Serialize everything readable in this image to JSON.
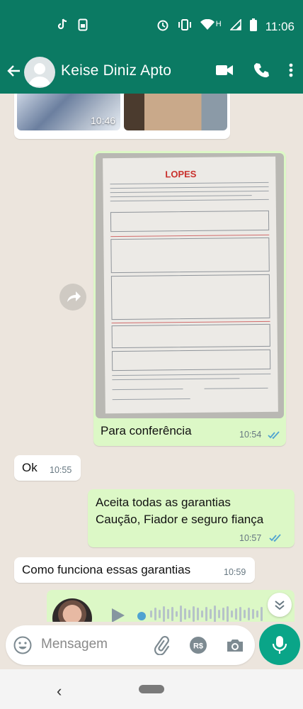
{
  "status_bar": {
    "time": "11:06",
    "network_letter": "H"
  },
  "header": {
    "title": "Keise Diniz Apto"
  },
  "media_preview": {
    "time": "10:46"
  },
  "document_message": {
    "doc_logo": "LOPES",
    "caption": "Para conferência",
    "time": "10:54",
    "status": "read"
  },
  "messages": [
    {
      "id": "m1",
      "direction": "in",
      "text": "Ok",
      "time": "10:55"
    },
    {
      "id": "m2",
      "direction": "out",
      "lines": [
        "Aceita todas as garantias",
        "Caução, Fiador e seguro fiança"
      ],
      "time": "10:57",
      "status": "read"
    },
    {
      "id": "m3",
      "direction": "in",
      "text": "Como funciona essas garantias",
      "time": "10:59"
    }
  ],
  "composer": {
    "placeholder": "Mensagem"
  },
  "colors": {
    "header": "#0b7a63",
    "outgoing": "#dcf8c6",
    "incoming": "#ffffff",
    "accent": "#0aa588",
    "read_ticks": "#4fa3d1"
  },
  "icons": [
    "tiktok-icon",
    "sim-icon",
    "alarm-icon",
    "vibrate-icon",
    "wifi-icon",
    "signal-icon",
    "battery-icon",
    "back-arrow-icon",
    "video-call-icon",
    "phone-icon",
    "more-vert-icon",
    "forward-icon",
    "play-icon",
    "emoji-icon",
    "attach-icon",
    "payment-icon",
    "camera-icon",
    "mic-icon",
    "chevron-down-icon"
  ]
}
